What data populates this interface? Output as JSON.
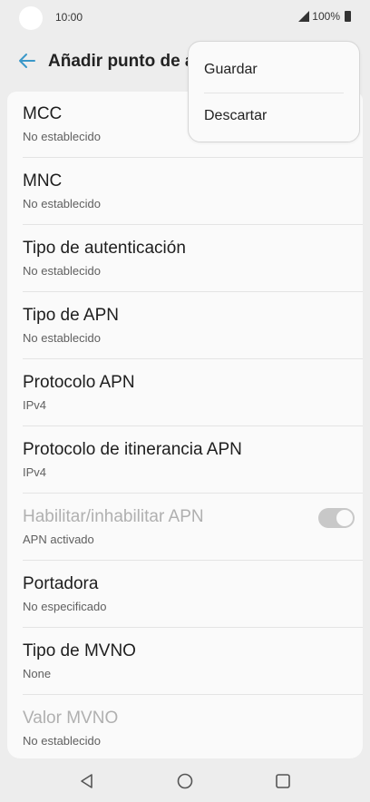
{
  "status_bar": {
    "time": "10:00",
    "battery": "100%"
  },
  "app_bar": {
    "title": "Añadir punto de a"
  },
  "overflow_menu": {
    "items": [
      "Guardar",
      "Descartar"
    ]
  },
  "settings": [
    {
      "title": "MCC",
      "summary": "No establecido"
    },
    {
      "title": "MNC",
      "summary": "No establecido"
    },
    {
      "title": "Tipo de autenticación",
      "summary": "No establecido"
    },
    {
      "title": "Tipo de APN",
      "summary": "No establecido"
    },
    {
      "title": "Protocolo APN",
      "summary": "IPv4"
    },
    {
      "title": "Protocolo de itinerancia APN",
      "summary": "IPv4"
    },
    {
      "title": "Habilitar/inhabilitar APN",
      "summary": "APN activado",
      "enabled": false,
      "toggle_on": true
    },
    {
      "title": "Portadora",
      "summary": "No especificado"
    },
    {
      "title": "Tipo de MVNO",
      "summary": "None"
    },
    {
      "title": "Valor MVNO",
      "summary": "No establecido",
      "enabled": false
    }
  ],
  "colors": {
    "background": "#ededed",
    "card": "#fafafa",
    "accent": "#3a98c9",
    "disabled_text": "#b0b0b0"
  },
  "icons": [
    "back-arrow-icon",
    "signal-icon",
    "battery-icon",
    "nav-back-icon",
    "nav-home-icon",
    "nav-recents-icon"
  ]
}
